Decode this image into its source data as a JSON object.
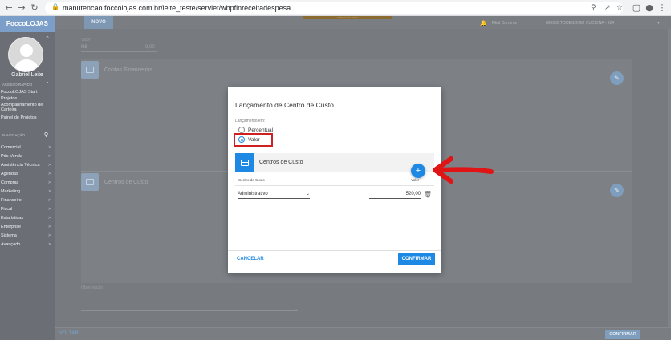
{
  "browser": {
    "url": "manutencao.foccolojas.com.br/leite_teste/servlet/wbpfinreceitadespesa",
    "back_icon": "back-arrow-icon",
    "forward_icon": "forward-arrow-icon",
    "reload_icon": "reload-icon",
    "lock_icon": "lock-icon"
  },
  "sidebar": {
    "brand": "FoccoLOJAS",
    "user_name": "Gabriel Leite",
    "acesso_rapido_label": "ACESSO RÁPIDO",
    "quick_items": [
      "FoccoLOJAS Start",
      "Projetos",
      "Acompanhamento de Carteira",
      "Painel de Projetos"
    ],
    "navegacao_label": "NAVEGAÇÃO",
    "nav_items": [
      "Comercial",
      "Pós-Venda",
      "Assistência Técnica",
      "Agendas",
      "Compras",
      "Marketing",
      "Financeiro",
      "Fiscal",
      "Estatísticas",
      "Enterprise",
      "Sistema",
      "Avançado"
    ]
  },
  "topbar": {
    "novo_label": "NOVO",
    "env_label": "Ambiente de Testes",
    "filial_label": "Filial Corrente",
    "filial_value": "800009 TOOESOHMI CUCCINA - 924"
  },
  "form": {
    "valor_label": "Valor*",
    "valor_prefix": "R$",
    "valor_value": "0,00",
    "contas_title": "Contas Financeiras",
    "centros_title": "Centros de Custo",
    "observacao_label": "Observação"
  },
  "footer": {
    "voltar_label": "VOLTAR",
    "confirmar_label": "CONFIRMAR"
  },
  "modal": {
    "title": "Lançamento de Centro de Custo",
    "lancamento_label": "Lançamento em:",
    "option_percentual": "Percentual",
    "option_valor": "Valor",
    "selected_option": "Valor",
    "section_title": "Centros de Custo",
    "col_centro": "Centro de Custo",
    "col_valor": "Valor",
    "row_centro": "Administrativo",
    "row_valor": "520,00",
    "cancel_label": "CANCELAR",
    "confirm_label": "CONFIRMAR"
  },
  "colors": {
    "accent": "#1e88e5",
    "highlight": "#d01f1f",
    "sidebar": "#6b6f75"
  }
}
